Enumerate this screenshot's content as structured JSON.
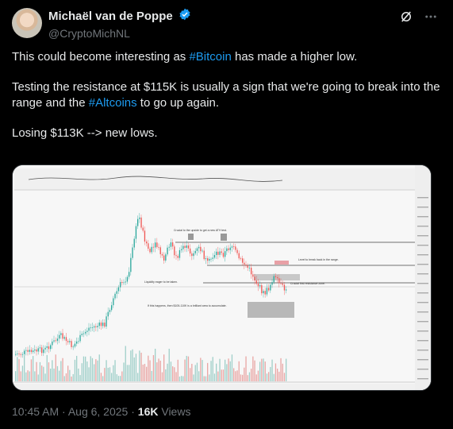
{
  "author": {
    "display_name": "Michaël van de Poppe",
    "handle": "@CryptoMichNL",
    "verified": true
  },
  "icons": {
    "avatar": "avatar",
    "verified": "verified-badge-icon",
    "grok": "grok-icon",
    "more": "more-icon"
  },
  "tweet": {
    "line1_pre": "This could become interesting as ",
    "line1_tag": "#Bitcoin",
    "line1_post": " has made a higher low.",
    "line2_pre": "Testing the resistance at $115K is usually a sign that we're going to break into the range and the ",
    "line2_tag": "#Altcoins",
    "line2_post": " to go up again.",
    "line3": "Losing $113K --> new lows."
  },
  "chart_image": {
    "annotations": {
      "sweep": "Crucial to the upside to get a new ATH test.",
      "range": "Level to break back in the range.",
      "resistance": "Crucial first resistance zone.",
      "liquidity": "Liquidity eager to be taken.",
      "happens": "If this happens, then $105-110K is a brilliant area to accumulate."
    }
  },
  "footer": {
    "time": "10:45 AM · Aug 6, 2025 · ",
    "views_count": "16K",
    "views_label": " Views"
  },
  "colors": {
    "accent": "#1d9bf0",
    "up_candle": "#26a69a",
    "down_candle": "#ef5350"
  }
}
